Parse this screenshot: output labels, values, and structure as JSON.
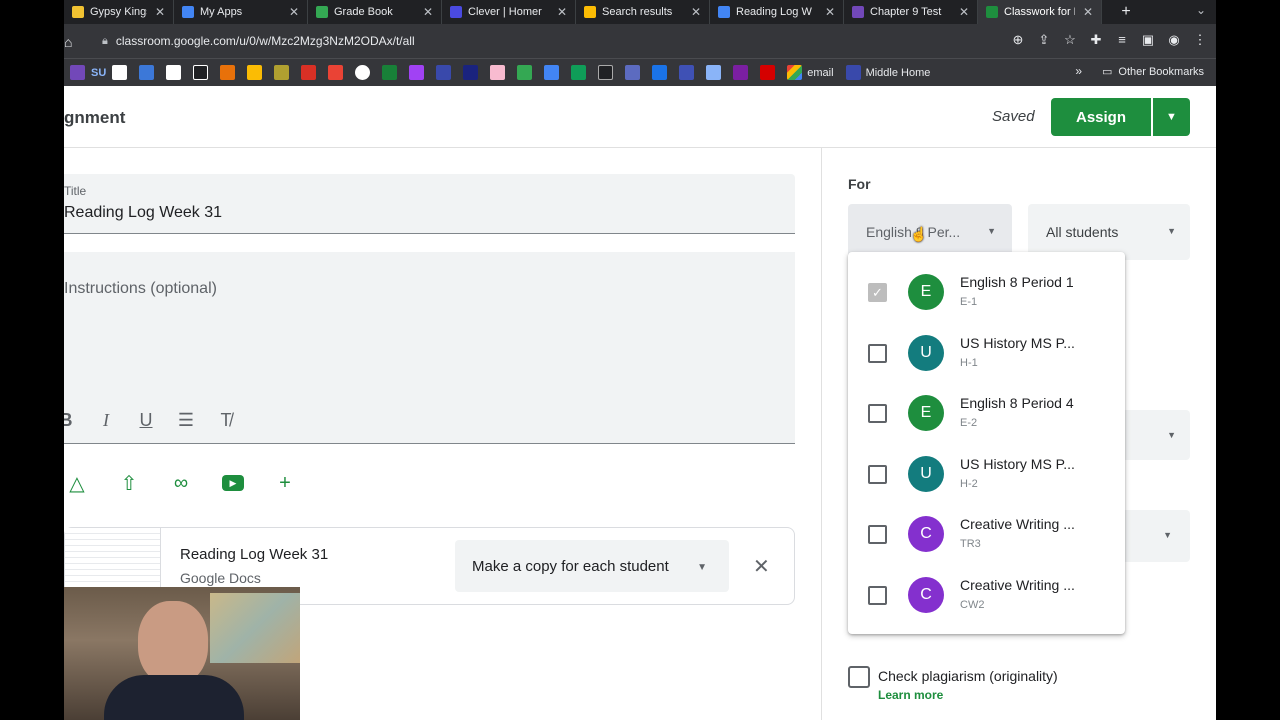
{
  "browser": {
    "tabs": [
      {
        "label": "Gypsy Kings Ins",
        "color": "#f1c232"
      },
      {
        "label": "My Apps",
        "color": "#4285f4"
      },
      {
        "label": "Grade Book",
        "color": "#34a853"
      },
      {
        "label": "Clever | Homer",
        "color": "#4a4ae0"
      },
      {
        "label": "Search results",
        "color": "#fbbc04"
      },
      {
        "label": "Reading Log W",
        "color": "#4285f4"
      },
      {
        "label": "Chapter 9 Test",
        "color": "#7248b9"
      },
      {
        "label": "Classwork for E",
        "color": "#1e8e3e",
        "active": true
      }
    ],
    "url": "classroom.google.com/u/0/w/Mzc2Mzg3NzM2ODAx/t/all",
    "bookmarks": {
      "email": "email",
      "middle_home": "Middle Home",
      "other": "Other Bookmarks",
      "su": "SU"
    }
  },
  "header": {
    "title": "gnment",
    "saved": "Saved",
    "assign": "Assign"
  },
  "form": {
    "title_label": "Title",
    "title_value": "Reading Log Week 31",
    "instructions_placeholder": "Instructions (optional)"
  },
  "attachment": {
    "title": "Reading Log Week 31",
    "subtitle": "Google Docs",
    "copy_option": "Make a copy for each student"
  },
  "sidebar": {
    "for_label": "For",
    "class_value": "English 8 Per...",
    "students_value": "All students",
    "plagiarism_label": "Check plagiarism (originality)",
    "learn_more": "Learn more"
  },
  "class_dropdown": [
    {
      "name": "English 8 Period 1",
      "section": "E-1",
      "initial": "E",
      "color": "#1e8e3e",
      "checked": true
    },
    {
      "name": "US History MS P...",
      "section": "H-1",
      "initial": "U",
      "color": "#137c7e",
      "checked": false
    },
    {
      "name": "English 8 Period 4",
      "section": "E-2",
      "initial": "E",
      "color": "#1e8e3e",
      "checked": false
    },
    {
      "name": "US History MS P...",
      "section": "H-2",
      "initial": "U",
      "color": "#137c7e",
      "checked": false
    },
    {
      "name": "Creative Writing ...",
      "section": "TR3",
      "initial": "C",
      "color": "#8430ce",
      "checked": false
    },
    {
      "name": "Creative Writing ...",
      "section": "CW2",
      "initial": "C",
      "color": "#8430ce",
      "checked": false
    }
  ]
}
